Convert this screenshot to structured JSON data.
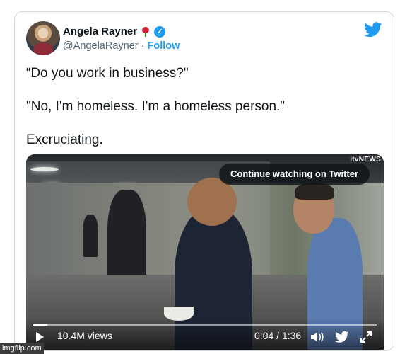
{
  "tweet": {
    "author_name": "Angela Rayner",
    "handle": "@AngelaRayner",
    "separator": "·",
    "follow_label": "Follow",
    "lines": [
      "“Do you work in business?\"",
      "\"No, I'm homeless. I'm a homeless person.\"",
      "Excruciating."
    ]
  },
  "video": {
    "channel_label": "itvNEWS",
    "continue_label": "Continue watching on Twitter",
    "views": "10.4M views",
    "time": "0:04 / 1:36",
    "progress_fraction": 0.042
  },
  "colors": {
    "brand_blue": "#1d9bf0",
    "rose_red": "#d0213a"
  },
  "icons": [
    "twitter-bird-icon",
    "verified-badge-icon",
    "rose-icon",
    "play-icon",
    "volume-icon",
    "expand-icon"
  ],
  "watermark": "imgflip.com"
}
